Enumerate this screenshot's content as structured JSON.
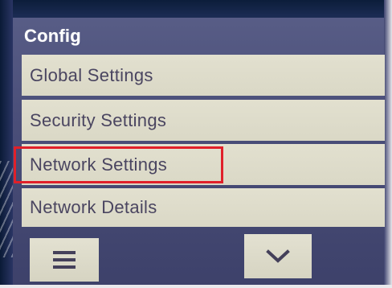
{
  "screen": {
    "title": "Config"
  },
  "menu": {
    "items": [
      {
        "label": "Global Settings"
      },
      {
        "label": "Security Settings"
      },
      {
        "label": "Network Settings"
      },
      {
        "label": "Network Details"
      }
    ],
    "highlighted_item": "Network Settings"
  },
  "footer": {
    "menu_icon": "hamburger-icon",
    "down_icon": "chevron-down-icon"
  },
  "colors": {
    "bezel": "#4b4f7a",
    "item_background": "#dad8c6",
    "item_text": "#4a4560",
    "highlight_box": "#e0202a"
  }
}
